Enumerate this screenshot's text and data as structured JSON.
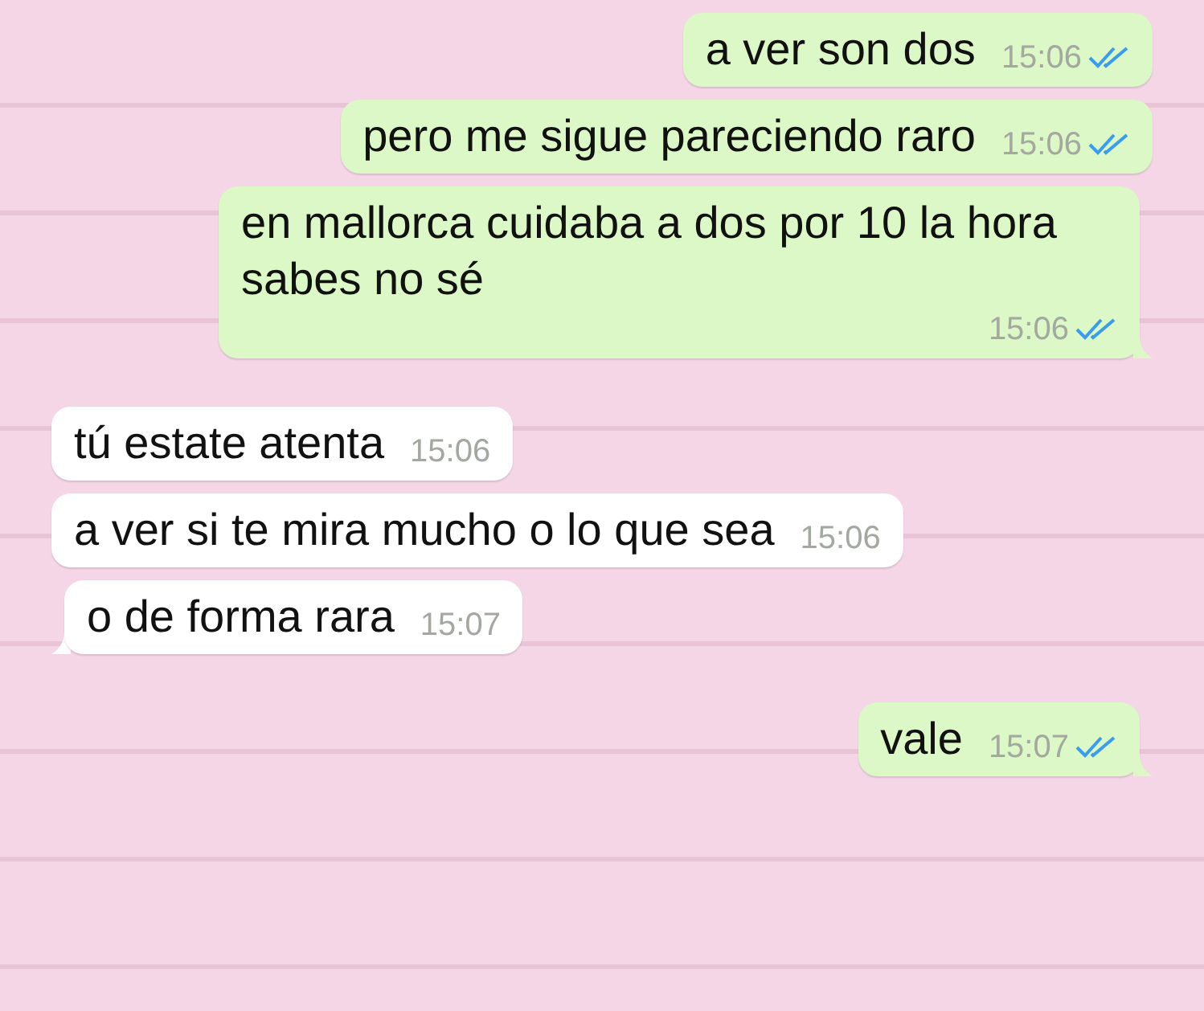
{
  "messages": [
    {
      "kind": "out",
      "text": "a ver son dos",
      "time": "15:06",
      "read": true,
      "tail": false
    },
    {
      "kind": "out",
      "text": "pero me sigue pareciendo raro",
      "time": "15:06",
      "read": true,
      "tail": false
    },
    {
      "kind": "out",
      "text": "en mallorca cuidaba a dos por 10 la hora sabes no sé",
      "time": "15:06",
      "read": true,
      "tail": true
    },
    {
      "kind": "in",
      "text": "tú estate atenta",
      "time": "15:06",
      "tail": false
    },
    {
      "kind": "in",
      "text": "a ver si te mira mucho o lo que sea",
      "time": "15:06",
      "tail": false
    },
    {
      "kind": "in",
      "text": "o de forma rara",
      "time": "15:07",
      "tail": true
    },
    {
      "kind": "out",
      "text": "vale",
      "time": "15:07",
      "read": true,
      "tail": true
    }
  ]
}
